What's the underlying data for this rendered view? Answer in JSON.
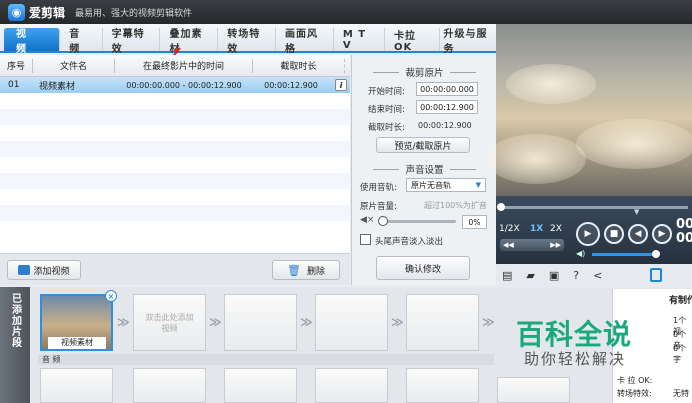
{
  "app": {
    "name": "爱剪辑",
    "slogan": "最易用、强大的视频剪辑软件"
  },
  "tabs": [
    "视 频",
    "音 频",
    "字幕特效",
    "叠加素材",
    "转场特效",
    "画面风格",
    "M T V",
    "卡拉OK",
    "升级与服务"
  ],
  "table": {
    "headers": [
      "序号",
      "文件名",
      "在最终影片中的时间",
      "截取时长"
    ],
    "rows": [
      {
        "index": "01",
        "name": "视频素材",
        "time": "00:00:00.000 - 00:00:12.900",
        "duration": "00:00:12.900"
      }
    ]
  },
  "list_actions": {
    "add_video": "添加视频",
    "delete": "删除"
  },
  "crop": {
    "title": "裁剪原片",
    "start_label": "开始时间:",
    "start_value": "00:00:00.000",
    "end_label": "结束时间:",
    "end_value": "00:00:12.900",
    "duration_label": "截取时长:",
    "duration_value": "00:00:12.900",
    "preview_button": "预览/截取原片"
  },
  "sound": {
    "title": "声音设置",
    "track_label": "使用音轨:",
    "track_value": "原片无音轨",
    "volume_label": "原片音量:",
    "volume_hint": "超过100%为扩音",
    "volume_value": "0%",
    "fade_label": "头尾声音淡入淡出",
    "confirm_button": "确认修改"
  },
  "player": {
    "speed_half": "1/2X",
    "speed_1": "1X",
    "speed_2": "2X",
    "time_partial": "00"
  },
  "clips": {
    "side_label": "已添加片段",
    "clip_name": "视频素材",
    "placeholder": "双击此处添加视频",
    "audio_label": "音 频"
  },
  "info_panel": {
    "heading": "有制作",
    "lines": [
      "1个视",
      "0个音",
      "0个字"
    ],
    "karaoke": "卡 拉 OK:",
    "transition_label": "转场特效:",
    "transition_value": "无特"
  },
  "watermark": {
    "title": "百科全说",
    "subtitle": "助你轻松解决"
  },
  "colors": {
    "accent": "#1c86d8",
    "titlebar": "#2b2d31",
    "selection": "#9ccdf0",
    "watermark": "#1aa97b"
  }
}
